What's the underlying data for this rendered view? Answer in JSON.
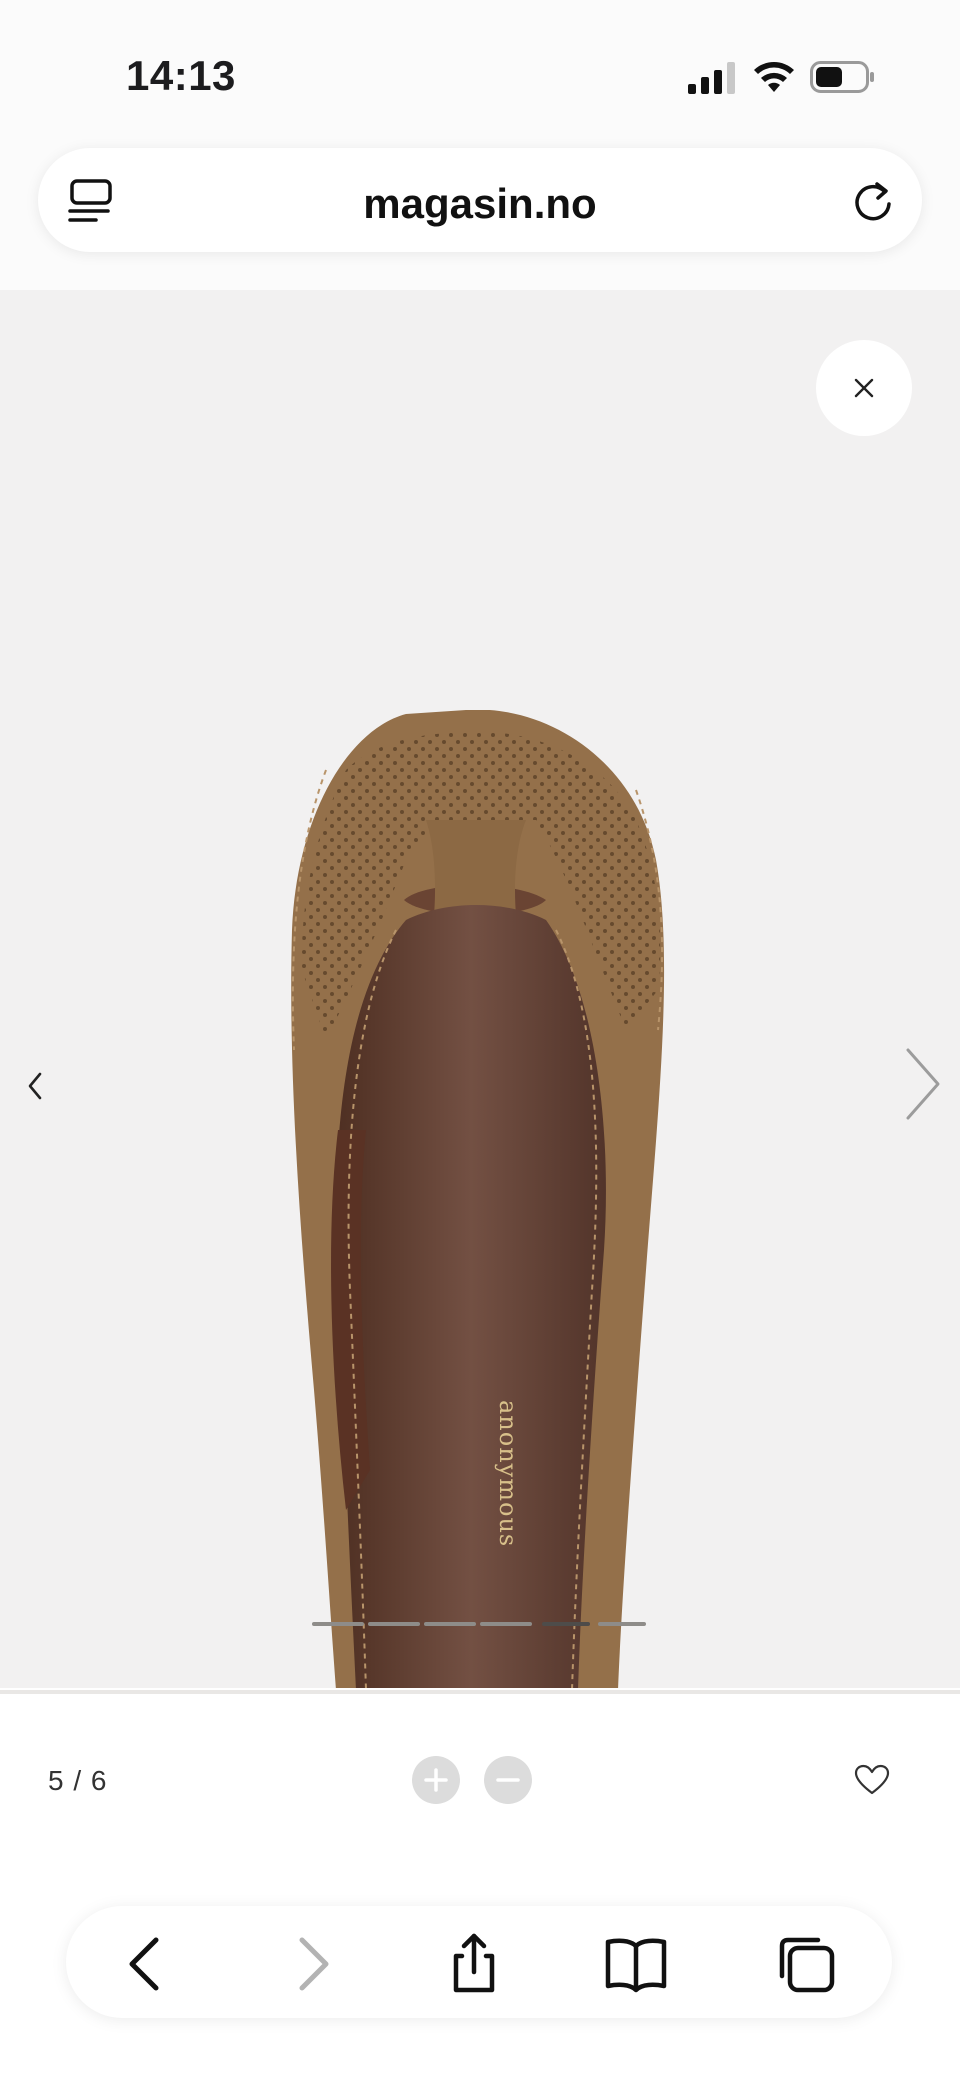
{
  "status_bar": {
    "time": "14:13",
    "battery_level": 0.5
  },
  "browser": {
    "url": "magasin.no"
  },
  "viewer": {
    "current_index": 5,
    "total": 6,
    "counter_text": "5 / 6",
    "image_brand_label": "anonymous",
    "image_description": "brown suede peep-toe ballet flat, top view"
  },
  "icons": {
    "reader": "reader-mode-icon",
    "reload": "reload-icon",
    "close": "close-icon",
    "prev": "chevron-left-icon",
    "next": "chevron-right-icon",
    "zoom_in": "plus-icon",
    "zoom_out": "minus-icon",
    "favorite": "heart-icon",
    "back": "back-arrow-icon",
    "forward": "forward-arrow-icon",
    "share": "share-icon",
    "bookmarks": "book-icon",
    "tabs": "tabs-icon"
  },
  "colors": {
    "viewer_background": "#f2f1f1",
    "shoe_suede": "#94704a",
    "shoe_lining": "#6a4433"
  }
}
